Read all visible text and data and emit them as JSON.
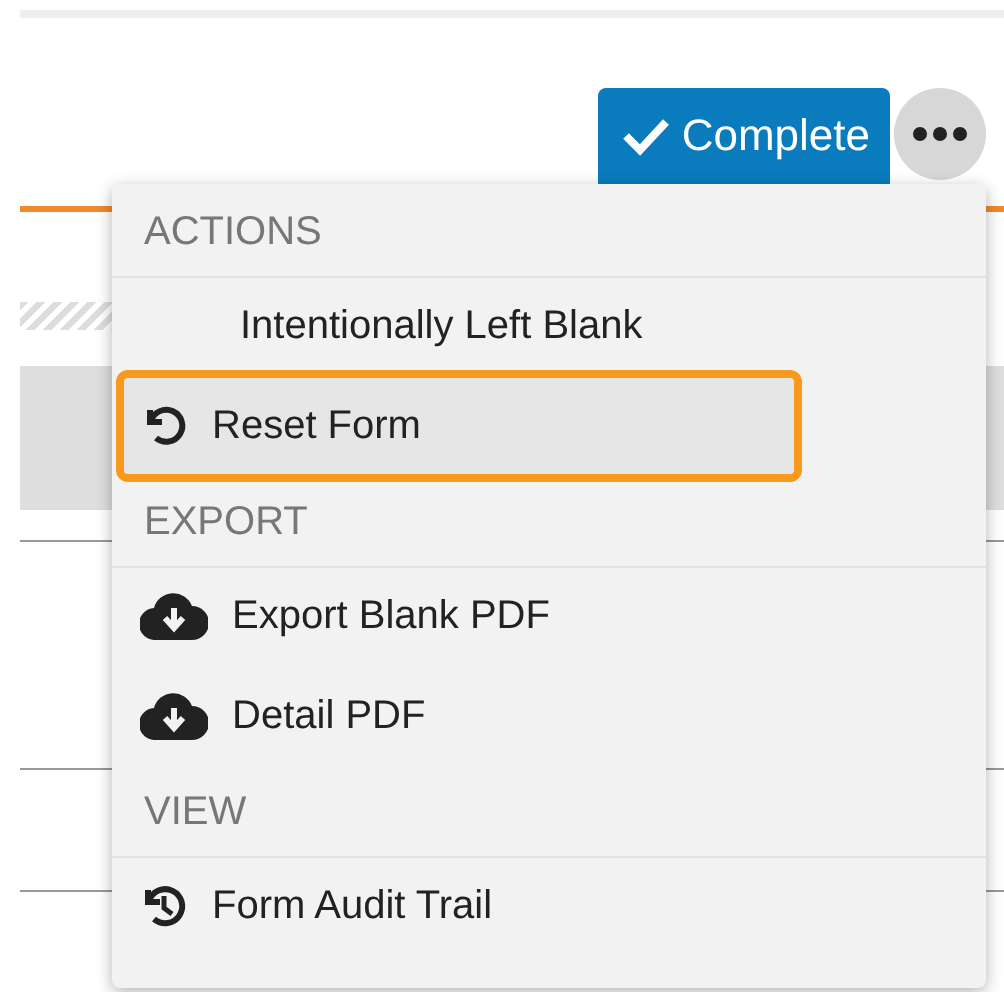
{
  "toolbar": {
    "complete_button": {
      "label": "Complete"
    }
  },
  "menu": {
    "open": true,
    "sections": [
      {
        "heading": "ACTIONS",
        "items": [
          {
            "label": "Intentionally Left Blank",
            "kind": "plain",
            "selected": false
          },
          {
            "label": "Reset Form",
            "kind": "reset",
            "selected": true
          }
        ]
      },
      {
        "heading": "EXPORT",
        "items": [
          {
            "label": "Export Blank PDF",
            "kind": "download",
            "selected": false
          },
          {
            "label": "Detail PDF",
            "kind": "download",
            "selected": false
          }
        ]
      },
      {
        "heading": "VIEW",
        "items": [
          {
            "label": "Form Audit Trail",
            "kind": "history",
            "selected": false
          }
        ]
      }
    ]
  }
}
